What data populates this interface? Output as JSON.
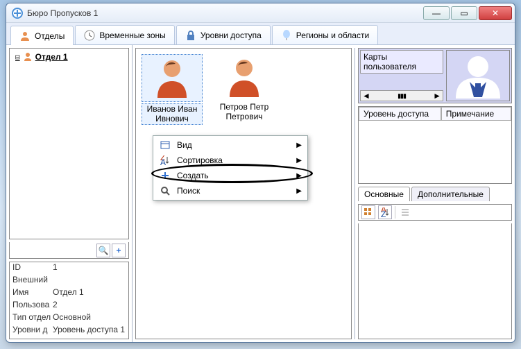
{
  "window": {
    "title": "Бюро Пропусков 1"
  },
  "tabs": [
    {
      "label": "Отделы"
    },
    {
      "label": "Временные зоны"
    },
    {
      "label": "Уровни доступа"
    },
    {
      "label": "Регионы и области"
    }
  ],
  "tree": {
    "node0": "Отдел 1"
  },
  "users": [
    {
      "name": "Иванов Иван Ивнович"
    },
    {
      "name": "Петров Петр Петрович"
    }
  ],
  "props": [
    {
      "k": "ID",
      "v": "1"
    },
    {
      "k": "Внешний",
      "v": ""
    },
    {
      "k": "Имя",
      "v": "Отдел 1"
    },
    {
      "k": "Пользова",
      "v": "2"
    },
    {
      "k": "Тип отдел",
      "v": "Основной"
    },
    {
      "k": "Уровни д",
      "v": "Уровень доступа 1"
    }
  ],
  "cards": {
    "header": "Карты пользователя"
  },
  "levels": {
    "col1": "Уровень доступа",
    "col2": "Примечание"
  },
  "detailtabs": {
    "t1": "Основные",
    "t2": "Дополнительные"
  },
  "ctx": {
    "view": "Вид",
    "sort": "Сортировка",
    "create": "Создать",
    "search": "Поиск"
  },
  "icons": {
    "search": "🔍",
    "plus": "+",
    "minimize": "—",
    "maximize": "▭",
    "close": "✕",
    "arrowLeft": "◄",
    "arrowRight": "►",
    "submenu": "▶",
    "collapse": "⊟"
  }
}
